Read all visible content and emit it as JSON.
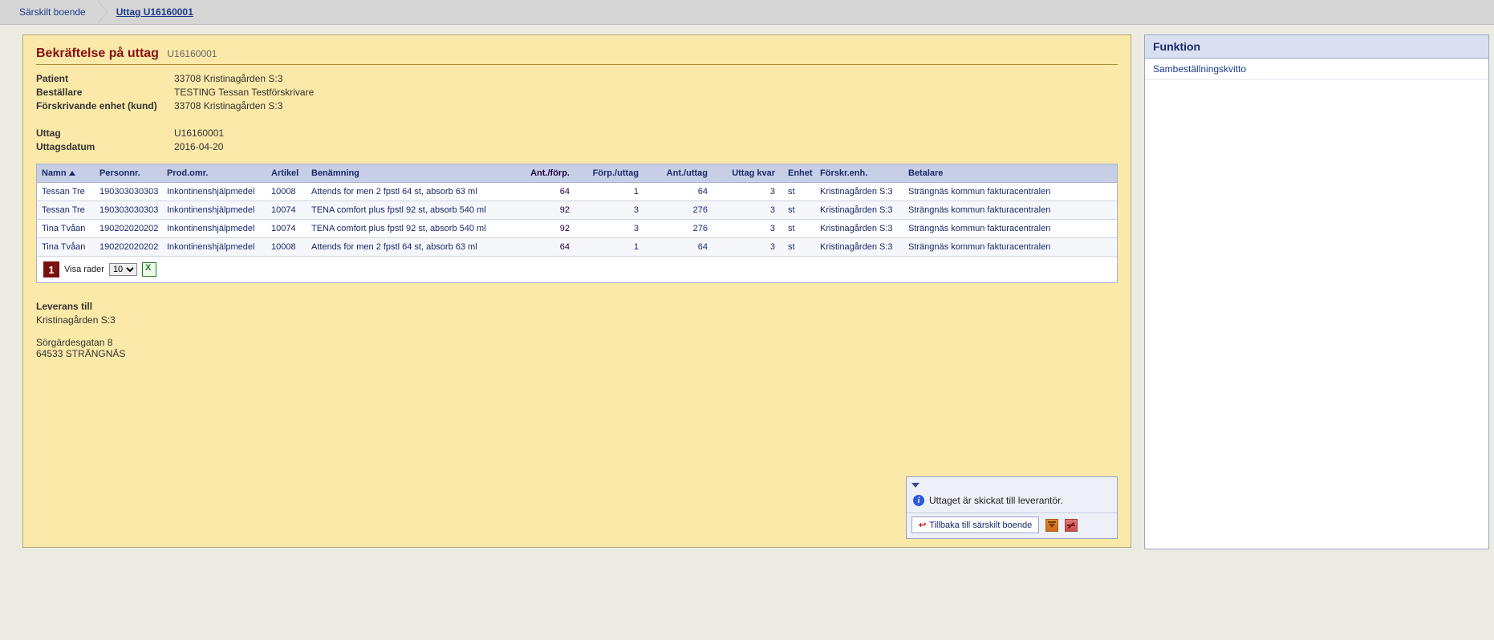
{
  "breadcrumb": {
    "root": "Särskilt boende",
    "current": "Uttag U16160001"
  },
  "page": {
    "title": "Bekräftelse på uttag",
    "code": "U16160001"
  },
  "meta": {
    "patient": {
      "k": "Patient",
      "v": "33708 Kristinagården S:3"
    },
    "bestallare": {
      "k": "Beställare",
      "v": "TESTING Tessan Testförskrivare"
    },
    "kund": {
      "k": "Förskrivande enhet (kund)",
      "v": "33708 Kristinagården S:3"
    },
    "uttag": {
      "k": "Uttag",
      "v": "U16160001"
    },
    "datum": {
      "k": "Uttagsdatum",
      "v": "2016-04-20"
    }
  },
  "headers": {
    "name": "Namn",
    "pn": "Personnr.",
    "prod": "Prod.omr.",
    "art": "Artikel",
    "des": "Benämning",
    "apf": "Ant./förp.",
    "fpu": "Förp./uttag",
    "apu": "Ant./uttag",
    "kvar": "Uttag kvar",
    "unit": "Enhet",
    "fe": "Förskr.enh.",
    "bet": "Betalare"
  },
  "rows": [
    {
      "name": "Tessan Tre",
      "pn": "190303030303",
      "prod": "Inkontinenshjälpmedel",
      "art": "10008",
      "des": "Attends for men 2 fpstl 64 st, absorb 63 ml",
      "apf": "64",
      "fpu": "1",
      "apu": "64",
      "kvar": "3",
      "unit": "st",
      "fe": "Kristinagården S:3",
      "bet": "Strängnäs kommun fakturacentralen"
    },
    {
      "name": "Tessan Tre",
      "pn": "190303030303",
      "prod": "Inkontinenshjälpmedel",
      "art": "10074",
      "des": "TENA comfort plus fpstl 92 st, absorb 540 ml",
      "apf": "92",
      "fpu": "3",
      "apu": "276",
      "kvar": "3",
      "unit": "st",
      "fe": "Kristinagården S:3",
      "bet": "Strängnäs kommun fakturacentralen"
    },
    {
      "name": "Tina Tvåan",
      "pn": "190202020202",
      "prod": "Inkontinenshjälpmedel",
      "art": "10074",
      "des": "TENA comfort plus fpstl 92 st, absorb 540 ml",
      "apf": "92",
      "fpu": "3",
      "apu": "276",
      "kvar": "3",
      "unit": "st",
      "fe": "Kristinagården S:3",
      "bet": "Strängnäs kommun fakturacentralen"
    },
    {
      "name": "Tina Tvåan",
      "pn": "190202020202",
      "prod": "Inkontinenshjälpmedel",
      "art": "10008",
      "des": "Attends for men 2 fpstl 64 st, absorb 63 ml",
      "apf": "64",
      "fpu": "1",
      "apu": "64",
      "kvar": "3",
      "unit": "st",
      "fe": "Kristinagården S:3",
      "bet": "Strängnäs kommun fakturacentralen"
    }
  ],
  "pager": {
    "page": "1",
    "label": "Visa rader",
    "value": "10"
  },
  "delivery": {
    "h": "Leverans till",
    "l1": "Kristinagården S:3",
    "l2": "Sörgärdesgatan 8",
    "l3": "64533 STRÄNGNÄS"
  },
  "bottom": {
    "msg": "Uttaget är skickat till leverantör.",
    "back": "Tillbaka till särskilt boende"
  },
  "side": {
    "h": "Funktion",
    "i1": "Sambeställningskvitto"
  }
}
